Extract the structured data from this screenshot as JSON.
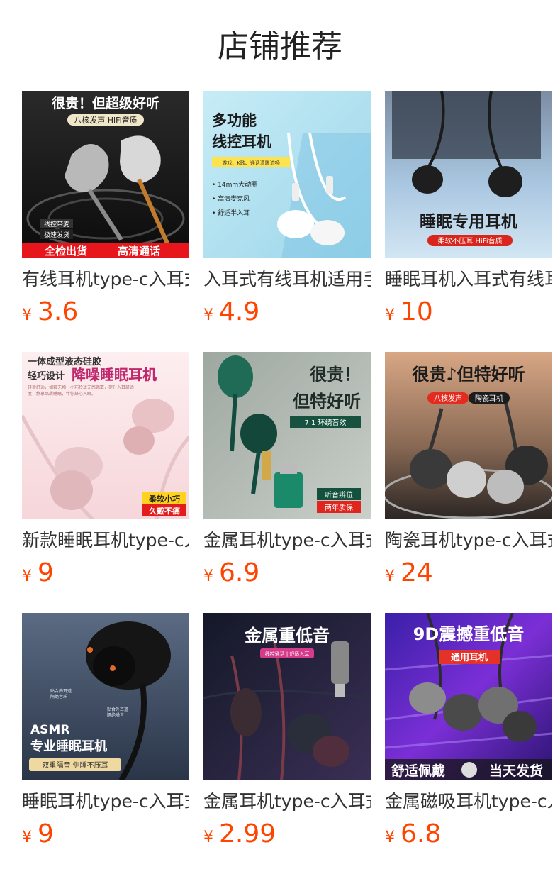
{
  "page": {
    "title": "店铺推荐"
  },
  "currency_symbol": "¥",
  "products": [
    {
      "title": "有线耳机type-c入耳式",
      "price": "3.6",
      "image": {
        "headline": "很贵！但超级好听",
        "tag": "八核发声 HiFi音质",
        "badge1": "线控带麦",
        "badge2": "极速发货",
        "bar_left": "全检出货",
        "bar_right": "高清通话"
      }
    },
    {
      "title": "入耳式有线耳机适用手机",
      "price": "4.9",
      "image": {
        "line1": "多功能",
        "line2": "线控耳机",
        "tag": "游戏、K歌、通话清晰流畅",
        "bullet1": "• 14mm大动圈",
        "bullet2": "• 高清麦克风",
        "bullet3": "• 舒适半入耳"
      }
    },
    {
      "title": "睡眠耳机入耳式有线耳机",
      "price": "10",
      "image": {
        "headline": "睡眠专用耳机",
        "tag": "柔软不压耳 HiFi音质"
      }
    },
    {
      "title": "新款睡眠耳机type-c入耳",
      "price": "9",
      "image": {
        "line1": "一体成型液态硅胶",
        "line2a": "轻巧设计",
        "line2b": "降噪睡眠耳机",
        "small": "轻盈舒适，如若无物，小巧玲珑无感佩戴，提升入耳舒适度，静享品质睡眠，伴你舒心入眠。",
        "badge1": "柔软小巧",
        "badge2": "久戴不痛"
      }
    },
    {
      "title": "金属耳机type-c入耳式",
      "price": "6.9",
      "image": {
        "line1": "很贵！",
        "line2": "但特好听",
        "tag": "7.1 环绕音效",
        "badge1": "听音辨位",
        "badge2": "两年质保"
      }
    },
    {
      "title": "陶瓷耳机type-c入耳式",
      "price": "24",
      "image": {
        "headline": "很贵♪但特好听",
        "tag1": "八核发声",
        "tag2": "陶瓷耳机"
      }
    },
    {
      "title": "睡眠耳机type-c入耳式",
      "price": "9",
      "image": {
        "note1": "贴合内耳道",
        "note1b": "隔绝音乐",
        "note2": "贴合外耳道",
        "note2b": "隔绝噪音",
        "line1": "ASMR",
        "line2": "专业睡眠耳机",
        "tag": "双重隔音 侧睡不压耳"
      }
    },
    {
      "title": "金属耳机type-c入耳式",
      "price": "2.99",
      "image": {
        "headline": "金属重低音",
        "tag": "线控通话 | 舒适入耳"
      }
    },
    {
      "title": "金属磁吸耳机type-c入耳",
      "price": "6.8",
      "image": {
        "headline": "9D震撼重低音",
        "tag": "通用耳机",
        "bar_left": "舒适佩戴",
        "bar_right": "当天发货"
      }
    }
  ]
}
